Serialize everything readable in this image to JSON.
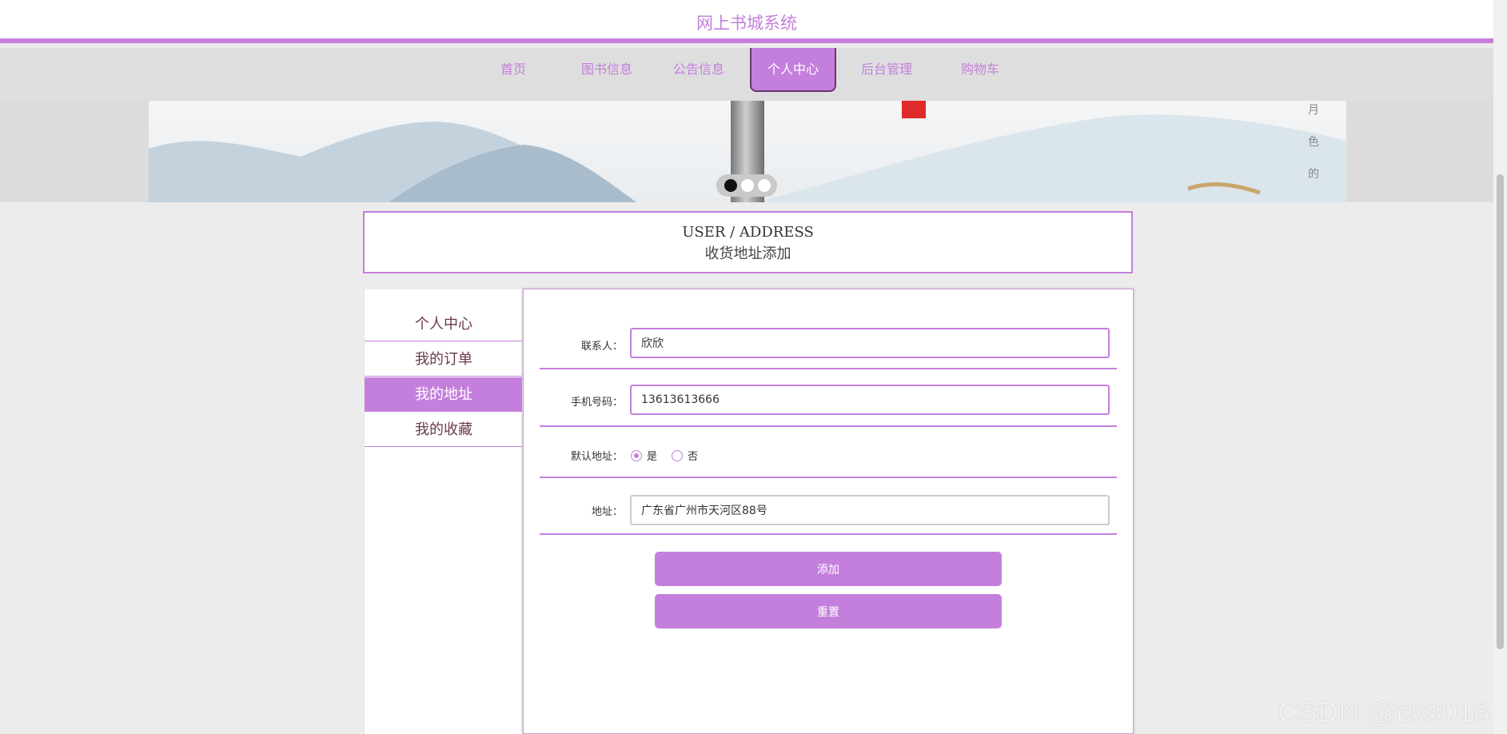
{
  "site": {
    "title": "网上书城系统"
  },
  "nav": {
    "items": [
      {
        "label": "首页"
      },
      {
        "label": "图书信息"
      },
      {
        "label": "公告信息"
      },
      {
        "label": "个人中心",
        "active": true
      },
      {
        "label": "后台管理"
      },
      {
        "label": "购物车"
      }
    ]
  },
  "banner": {
    "dots": 3,
    "active_dot": 1
  },
  "heading": {
    "en": "USER / ADDRESS",
    "zh": "收货地址添加"
  },
  "sidebar": {
    "items": [
      {
        "label": "个人中心"
      },
      {
        "label": "我的订单"
      },
      {
        "label": "我的地址",
        "active": true
      },
      {
        "label": "我的收藏"
      }
    ]
  },
  "form": {
    "contact": {
      "label": "联系人：",
      "value": "欣欣"
    },
    "phone": {
      "label": "手机号码：",
      "value": "13613613666"
    },
    "default": {
      "label": "默认地址：",
      "options": [
        "是",
        "否"
      ],
      "selected": "是"
    },
    "address": {
      "label": "地址：",
      "value": "广东省广州市天河区88号"
    },
    "submit_label": "添加",
    "reset_label": "重置"
  },
  "watermark": "CSDN @ck3018",
  "colors": {
    "accent": "#c47fdc",
    "background": "#ececec",
    "text_dark": "#6b3a4c"
  }
}
